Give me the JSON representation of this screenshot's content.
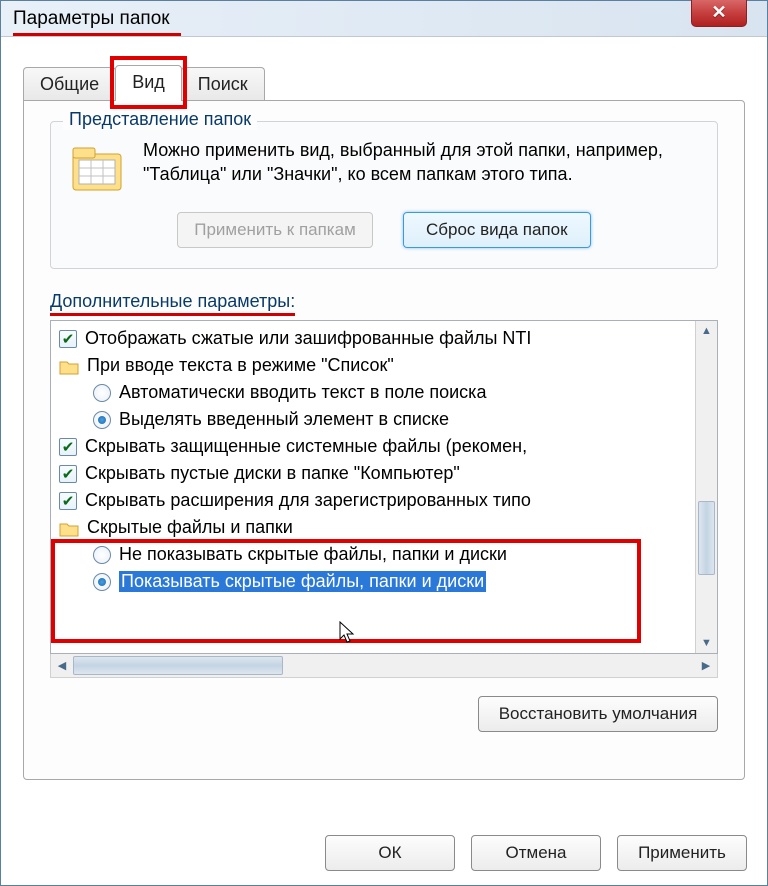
{
  "window": {
    "title": "Параметры папок"
  },
  "tabs": {
    "general": "Общие",
    "view": "Вид",
    "search": "Поиск"
  },
  "folderView": {
    "groupLabel": "Представление папок",
    "desc": "Можно применить вид, выбранный для этой папки, например, \"Таблица\" или \"Значки\", ко всем папкам этого типа.",
    "applyBtn": "Применить к папкам",
    "resetBtn": "Сброс вида папок"
  },
  "advanced": {
    "label": "Дополнительные параметры:",
    "items": {
      "i0": "Отображать сжатые или зашифрованные файлы NTI",
      "i1": "При вводе текста в режиме \"Список\"",
      "i1a": "Автоматически вводить текст в поле поиска",
      "i1b": "Выделять введенный элемент в списке",
      "i2": "Скрывать защищенные системные файлы (рекомен,",
      "i3": "Скрывать пустые диски в папке \"Компьютер\"",
      "i4": "Скрывать расширения для зарегистрированных типо",
      "i5": "Скрытые файлы и папки",
      "i5a": "Не показывать скрытые файлы, папки и диски",
      "i5b": "Показывать скрытые файлы, папки и диски"
    },
    "restore": "Восстановить умолчания"
  },
  "footer": {
    "ok": "ОК",
    "cancel": "Отмена",
    "apply": "Применить"
  }
}
